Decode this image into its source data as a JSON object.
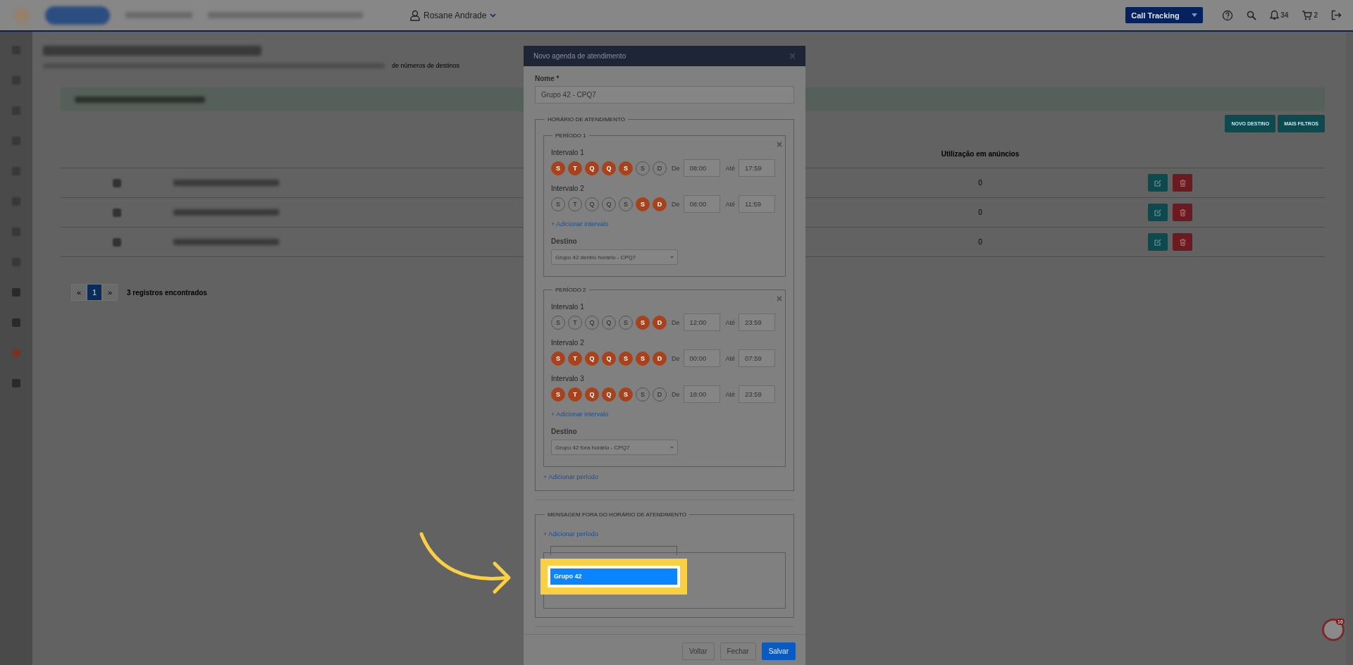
{
  "top_bar": {
    "user": "Rosane Andrade",
    "product": "Call Tracking",
    "notifications": "34",
    "cart": "2"
  },
  "page": {
    "breadcrumb_tail": "de números de destinos",
    "actions": [
      "NOVO DESTINO",
      "MAIS FILTROS"
    ],
    "table": {
      "usage_header": "Utilização em anúncios",
      "rows": [
        {
          "usage": "0"
        },
        {
          "usage": "0"
        },
        {
          "usage": "0"
        }
      ]
    },
    "pagination": {
      "prev": "«",
      "pages": [
        {
          "label": "1",
          "selected": true
        }
      ],
      "next": "»",
      "count": "3 registros encontrados"
    }
  },
  "modal": {
    "title": "Novo agenda de atendimento",
    "name_label": "Nome *",
    "name_value": "Grupo 42 - CPQ7",
    "hours_legend": "HORÁRIO DE ATENDIMENTO",
    "periods": [
      {
        "legend": "PERÍODO 1",
        "intervals": [
          {
            "label": "Intervalo 1",
            "from_label": "De",
            "from": "08:00",
            "to_label": "Até",
            "to": "17:59",
            "days": [
              {
                "letter": "S",
                "on": true
              },
              {
                "letter": "T",
                "on": true
              },
              {
                "letter": "Q",
                "on": true
              },
              {
                "letter": "Q",
                "on": true
              },
              {
                "letter": "S",
                "on": true
              },
              {
                "letter": "S",
                "on": false
              },
              {
                "letter": "D",
                "on": false
              }
            ]
          },
          {
            "label": "Intervalo 2",
            "from_label": "De",
            "from": "08:00",
            "to_label": "Até",
            "to": "11:59",
            "days": [
              {
                "letter": "S",
                "on": false
              },
              {
                "letter": "T",
                "on": false
              },
              {
                "letter": "Q",
                "on": false
              },
              {
                "letter": "Q",
                "on": false
              },
              {
                "letter": "S",
                "on": false
              },
              {
                "letter": "S",
                "on": true
              },
              {
                "letter": "D",
                "on": true
              }
            ]
          }
        ],
        "add_interval": "+ Adicionar intervalo",
        "destination_label": "Destino",
        "destination": "Grupo 42 dentro horário - CPQ7"
      },
      {
        "legend": "PERÍODO 2",
        "intervals": [
          {
            "label": "Intervalo 1",
            "from_label": "De",
            "from": "12:00",
            "to_label": "Até",
            "to": "23:59",
            "days": [
              {
                "letter": "S",
                "on": false
              },
              {
                "letter": "T",
                "on": false
              },
              {
                "letter": "Q",
                "on": false
              },
              {
                "letter": "Q",
                "on": false
              },
              {
                "letter": "S",
                "on": false
              },
              {
                "letter": "S",
                "on": true
              },
              {
                "letter": "D",
                "on": true
              }
            ]
          },
          {
            "label": "Intervalo 2",
            "from_label": "De",
            "from": "00:00",
            "to_label": "Até",
            "to": "07:59",
            "days": [
              {
                "letter": "S",
                "on": true
              },
              {
                "letter": "T",
                "on": true
              },
              {
                "letter": "Q",
                "on": true
              },
              {
                "letter": "Q",
                "on": true
              },
              {
                "letter": "S",
                "on": true
              },
              {
                "letter": "S",
                "on": true
              },
              {
                "letter": "D",
                "on": true
              }
            ]
          },
          {
            "label": "Intervalo 3",
            "from_label": "De",
            "from": "18:00",
            "to_label": "Até",
            "to": "23:59",
            "days": [
              {
                "letter": "S",
                "on": true
              },
              {
                "letter": "T",
                "on": true
              },
              {
                "letter": "Q",
                "on": true
              },
              {
                "letter": "Q",
                "on": true
              },
              {
                "letter": "S",
                "on": true
              },
              {
                "letter": "S",
                "on": false
              },
              {
                "letter": "D",
                "on": false
              }
            ]
          }
        ],
        "add_interval": "+ Adicionar intervalo",
        "destination_label": "Destino",
        "destination": "Grupo 42 fora horário - CPQ7"
      }
    ],
    "add_period": "+ Adicionar período",
    "message_legend": "MENSAGEM FORA DO HORÁRIO DE ATENDIMENTO",
    "message_add": "+ Adicionar período",
    "dropdown_options": [
      {
        "label": "Grupo 42",
        "selected": true
      }
    ],
    "buttons": [
      {
        "label": "Voltar",
        "kind": "default"
      },
      {
        "label": "Fechar",
        "kind": "default"
      },
      {
        "label": "Salvar",
        "kind": "primary"
      }
    ]
  },
  "chat_badge": "16"
}
